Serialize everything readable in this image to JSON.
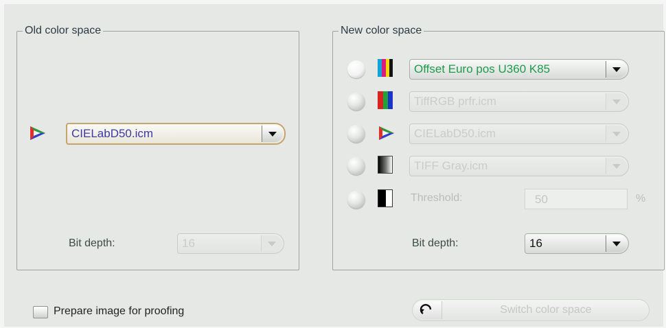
{
  "old_space": {
    "legend": "Old color space",
    "profile_value": "CIELabD50.icm",
    "bit_depth_label": "Bit depth:",
    "bit_depth_value": "16"
  },
  "new_space": {
    "legend": "New color space",
    "options": [
      {
        "value": "Offset Euro pos U360 K85",
        "enabled": true,
        "selected": true,
        "icon": "cmyk-swatch-icon"
      },
      {
        "value": "TiffRGB prfr.icm",
        "enabled": false,
        "selected": false,
        "icon": "rgb-swatch-icon"
      },
      {
        "value": "CIELabD50.icm",
        "enabled": false,
        "selected": false,
        "icon": "lab-triangle-icon"
      },
      {
        "value": "TIFF Gray.icm",
        "enabled": false,
        "selected": false,
        "icon": "grayscale-gradient-icon"
      }
    ],
    "threshold": {
      "label": "Threshold:",
      "value": "50",
      "unit": "%",
      "icon": "black-white-icon"
    },
    "bit_depth_label": "Bit depth:",
    "bit_depth_value": "16"
  },
  "proofing": {
    "label": "Prepare image for proofing",
    "checked": false
  },
  "switch_button": {
    "label": "Switch color space",
    "enabled": false,
    "icon": "undo-arrow-icon"
  },
  "colors": {
    "selected_text": "#1e9a4c",
    "label_text": "#3c4c44",
    "value_text": "#3b3aa0",
    "highlight_border": "#c5a56e"
  }
}
